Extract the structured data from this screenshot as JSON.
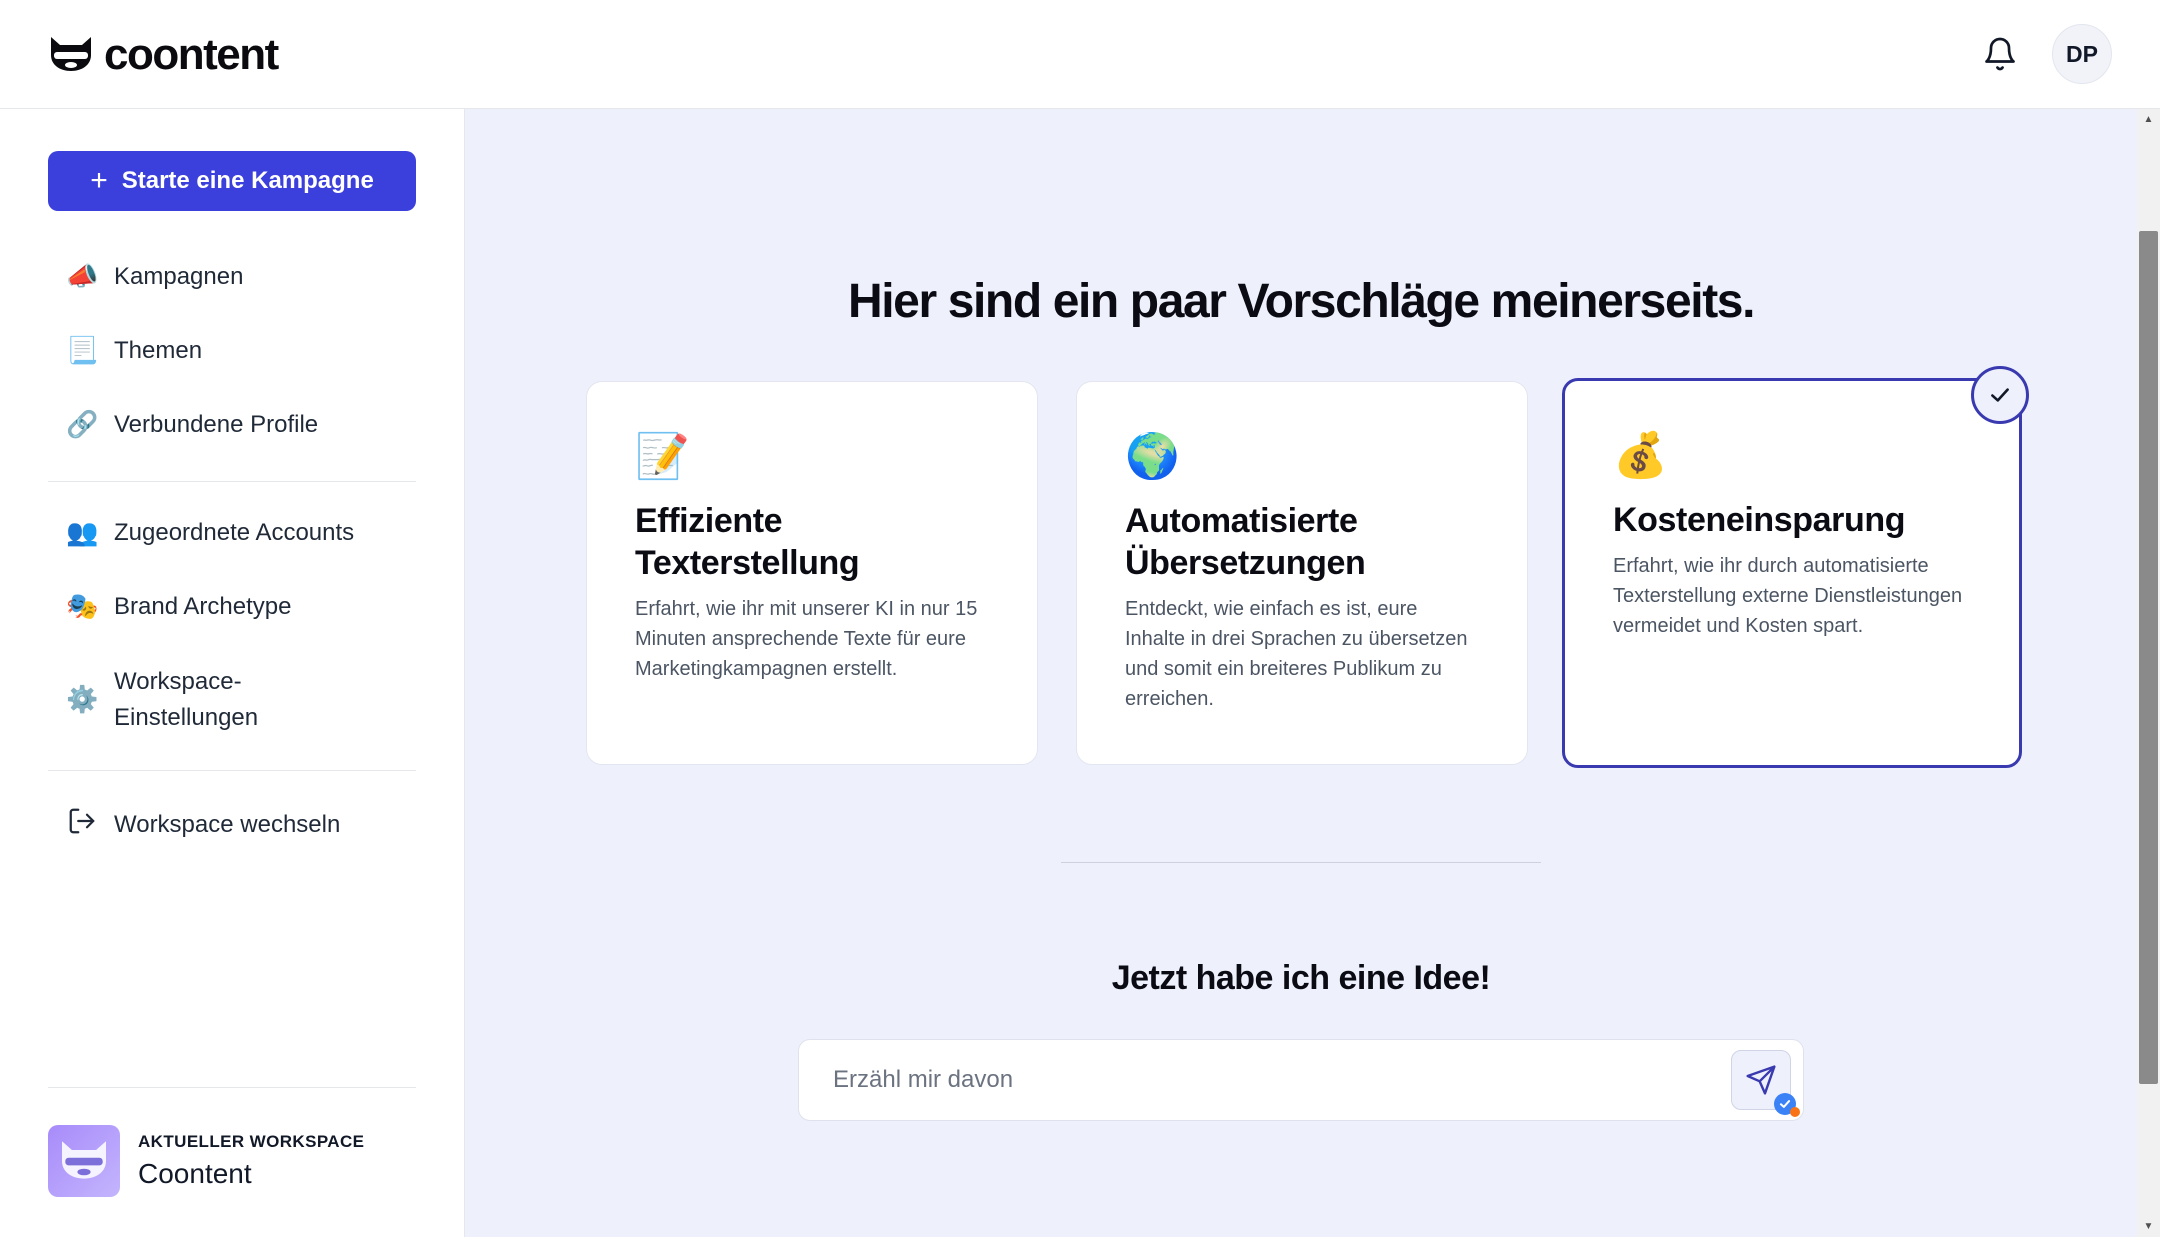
{
  "header": {
    "logo_text": "coontent",
    "notifications_icon": "bell-icon",
    "avatar_initials": "DP"
  },
  "sidebar": {
    "cta_label": "Starte eine Kampagne",
    "items": [
      {
        "icon": "📣",
        "icon_name": "megaphone-icon",
        "label": "Kampagnen"
      },
      {
        "icon": "📃",
        "icon_name": "document-icon",
        "label": "Themen"
      },
      {
        "icon": "🔗",
        "icon_name": "link-icon",
        "label": "Verbundene Profile"
      },
      {
        "icon": "👥",
        "icon_name": "users-icon",
        "label": "Zugeordnete Accounts"
      },
      {
        "icon": "🎭",
        "icon_name": "masks-icon",
        "label": "Brand Archetype"
      },
      {
        "icon": "⚙️",
        "icon_name": "gear-icon",
        "label_line1": "Workspace-",
        "label_line2": "Einstellungen"
      },
      {
        "icon_name": "logout-icon",
        "label": "Workspace wechseln"
      }
    ],
    "workspace": {
      "label": "AKTUELLER WORKSPACE",
      "name": "Coontent"
    }
  },
  "main": {
    "headline": "Hier sind ein paar Vorschläge meinerseits.",
    "cards": [
      {
        "icon": "📝",
        "icon_name": "memo-icon",
        "title": "Effiziente Texterstellung",
        "description": "Erfahrt, wie ihr mit unserer KI in nur 15 Minuten ansprechende Texte für eure Marketingkampagnen erstellt.",
        "selected": false
      },
      {
        "icon": "🌍",
        "icon_name": "globe-icon",
        "title": "Automatisierte Übersetzungen",
        "description": "Entdeckt, wie einfach es ist, eure Inhalte in drei Sprachen zu übersetzen und somit ein breiteres Publikum zu erreichen.",
        "selected": false
      },
      {
        "icon": "💰",
        "icon_name": "money-bag-icon",
        "title": "Kosteneinsparung",
        "description": "Erfahrt, wie ihr durch automatisierte Texterstellung externe Dienstleistungen vermeidet und Kosten spart.",
        "selected": true
      }
    ],
    "subhead": "Jetzt habe ich eine Idee!",
    "input": {
      "placeholder": "Erzähl mir davon",
      "value": ""
    }
  },
  "colors": {
    "accent": "#3b3fdc",
    "selected_border": "#3a3ab0",
    "main_background": "#eef0fc"
  }
}
